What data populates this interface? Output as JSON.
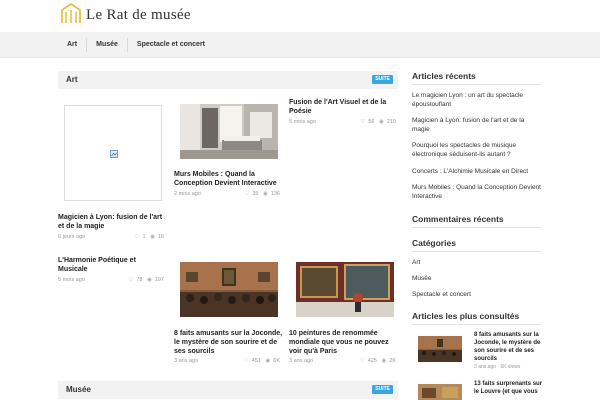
{
  "header": {
    "logo_text": "Le Rat de musée"
  },
  "nav": [
    "Art",
    "Musée",
    "Spectacle et concert"
  ],
  "sections": {
    "art_title": "Art",
    "musee_title": "Musée",
    "suite_label": "SUITE"
  },
  "articles": {
    "a1": {
      "title": "Magicien à Lyon: fusion de l'art et de la magie",
      "date": "6 jours ago",
      "likes": "1",
      "views": "16"
    },
    "a2": {
      "title": "Murs Mobiles : Quand la Conception Devient Interactive",
      "date": "2 mois ago",
      "likes": "35",
      "views": "136"
    },
    "a3": {
      "title": "Fusion de l'Art Visuel et de la Poésie",
      "date": "5 mois ago",
      "likes": "56",
      "views": "219"
    },
    "a4": {
      "title": "L'Harmonie Poétique et Musicale",
      "date": "5 mois ago",
      "likes": "78",
      "views": "197"
    },
    "a5": {
      "title": "8 faits amusants sur la Joconde, le mystère de son sourire et de ses sourcils",
      "date": "3 ans ago",
      "likes": "451",
      "views": "6K"
    },
    "a6": {
      "title": "10 peintures de renommée mondiale que vous ne pouvez voir qu'à Paris",
      "date": "3 ans ago",
      "likes": "425",
      "views": "2K"
    }
  },
  "sidebar": {
    "recent_heading": "Articles récents",
    "recent": [
      "Le magicien Lyon : un art du spectacle époustouflant",
      "Magicien à Lyon: fusion de l'art et de la magie",
      "Pourquoi les spectacles de musique électronique séduisent-ils autant ?",
      "Concerts : L'Alchimie Musicale en Direct",
      "Murs Mobiles : Quand la Conception Devient Interactive"
    ],
    "comments_heading": "Commentaires récents",
    "categories_heading": "Catégories",
    "categories": [
      "Art",
      "Musée",
      "Spectacle et concert"
    ],
    "popular_heading": "Articles les plus consultés",
    "popular": [
      {
        "title": "8 faits amusants sur la Joconde, le mystère de son sourire et de ses sourcils",
        "meta": "3 ans ago · 6K views"
      },
      {
        "title": "13 faits surprenants sur le Louvre (et que vous"
      }
    ]
  },
  "colors": {
    "accent": "#3aa6e0",
    "bar": "#f2f2f2"
  },
  "icons": {
    "like": "heart-icon",
    "view": "eye-icon",
    "broken": "broken-image-icon"
  }
}
